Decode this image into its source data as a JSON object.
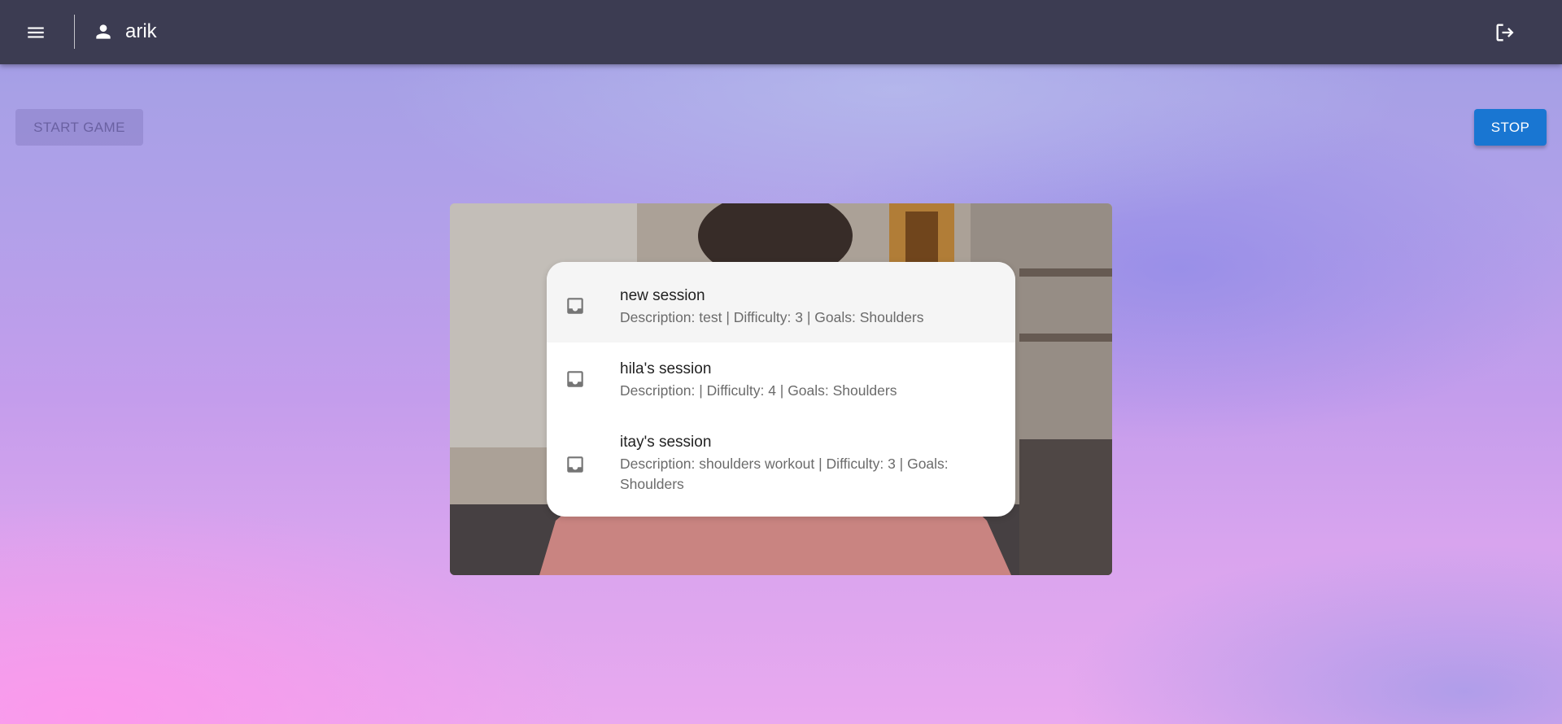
{
  "header": {
    "menu_icon": "menu-icon",
    "user_icon": "person-icon",
    "username": "arik",
    "logout_icon": "logout-icon"
  },
  "controls": {
    "start_label": "START GAME",
    "start_disabled": true,
    "stop_label": "STOP"
  },
  "sessions": [
    {
      "title": "new session",
      "description": "Description: test | Difficulty: 3 | Goals: Shoulders",
      "icon": "inbox-icon"
    },
    {
      "title": "hila's session",
      "description": "Description: | Difficulty: 4 | Goals: Shoulders",
      "icon": "inbox-icon"
    },
    {
      "title": "itay's session",
      "description": "Description: shoulders workout | Difficulty: 3 | Goals: Shoulders",
      "icon": "inbox-icon"
    }
  ],
  "colors": {
    "appbar": "#3c3c52",
    "primary": "#1976d2"
  }
}
